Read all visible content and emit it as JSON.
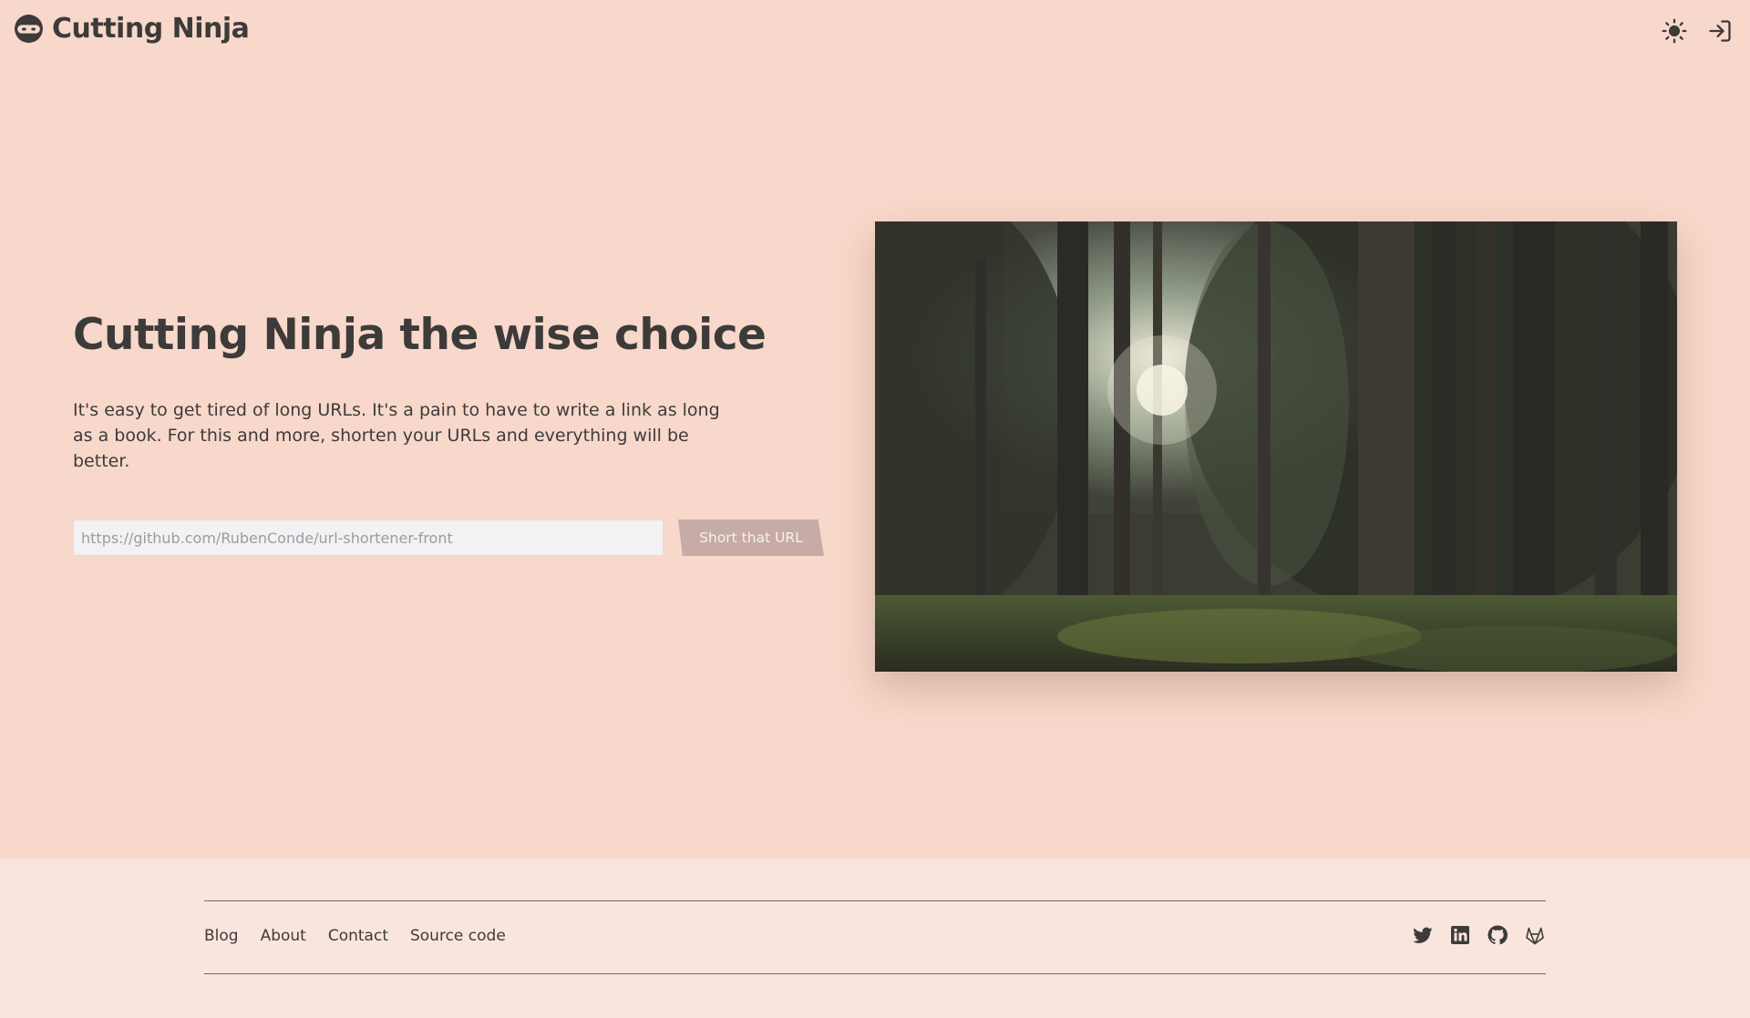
{
  "header": {
    "brand": "Cutting Ninja",
    "logo_icon": "ninja-face-icon",
    "actions": [
      {
        "name": "theme-toggle",
        "icon": "sun-icon"
      },
      {
        "name": "login",
        "icon": "sign-in-icon"
      }
    ]
  },
  "hero": {
    "title": "Cutting Ninja the wise choice",
    "description": "It's easy to get tired of long URLs. It's a pain to have to write a link as long as a book. For this and more, shorten your URLs and everything will be better.",
    "input_placeholder": "https://github.com/RubenConde/url-shortener-front",
    "input_value": "",
    "button_label": "Short that URL",
    "image_subject": "sunlit pine forest"
  },
  "footer": {
    "links": [
      "Blog",
      "About",
      "Contact",
      "Source code"
    ],
    "social": [
      "twitter-icon",
      "linkedin-icon",
      "github-icon",
      "gitlab-icon"
    ]
  },
  "colors": {
    "background": "#f8d8ca",
    "footer_background": "#f9e5dd",
    "text": "#3d3b3a",
    "button": "#c6aba6",
    "input": "#f2f2f3"
  }
}
